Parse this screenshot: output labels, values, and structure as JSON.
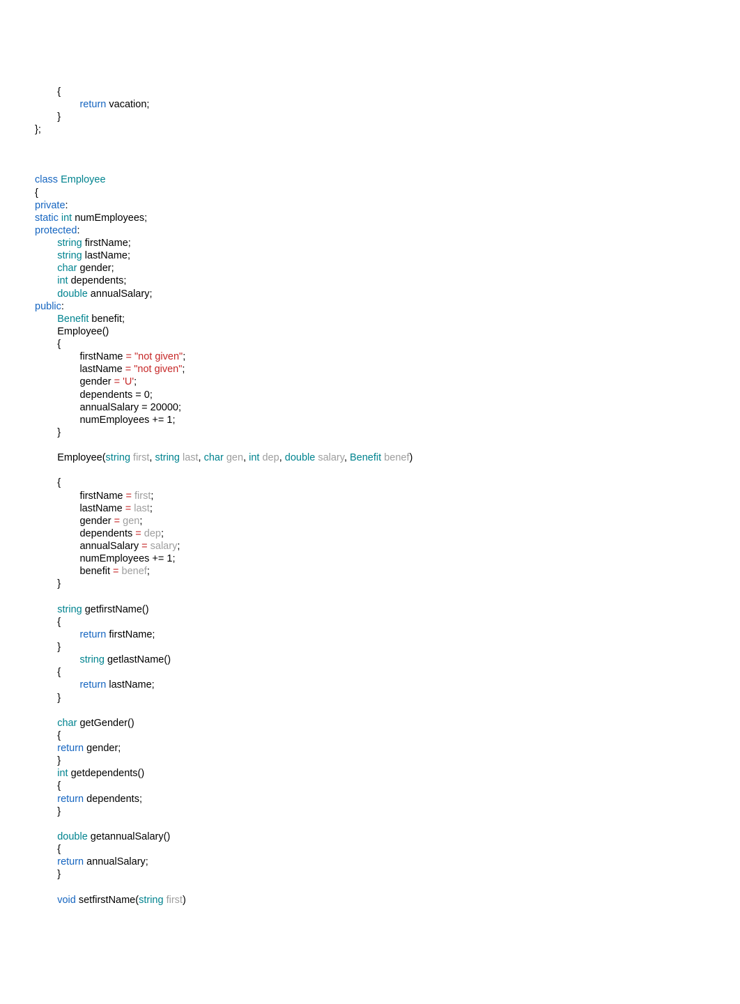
{
  "lines": [
    [
      {
        "t": "        {"
      }
    ],
    [
      {
        "t": "                "
      },
      {
        "t": "return",
        "c": "kw"
      },
      {
        "t": " vacation;"
      }
    ],
    [
      {
        "t": "        }"
      }
    ],
    [
      {
        "t": "};"
      }
    ],
    [
      {
        "t": ""
      }
    ],
    [
      {
        "t": ""
      }
    ],
    [
      {
        "t": ""
      }
    ],
    [
      {
        "t": "class",
        "c": "kw"
      },
      {
        "t": " "
      },
      {
        "t": "Employee",
        "c": "type"
      }
    ],
    [
      {
        "t": "{"
      }
    ],
    [
      {
        "t": "private",
        "c": "kw"
      },
      {
        "t": ":"
      }
    ],
    [
      {
        "t": "static",
        "c": "kw"
      },
      {
        "t": " "
      },
      {
        "t": "int",
        "c": "type"
      },
      {
        "t": " numEmployees;"
      }
    ],
    [
      {
        "t": "protected",
        "c": "kw"
      },
      {
        "t": ":"
      }
    ],
    [
      {
        "t": "        "
      },
      {
        "t": "string",
        "c": "type"
      },
      {
        "t": " firstName;"
      }
    ],
    [
      {
        "t": "        "
      },
      {
        "t": "string",
        "c": "type"
      },
      {
        "t": " lastName;"
      }
    ],
    [
      {
        "t": "        "
      },
      {
        "t": "char",
        "c": "type"
      },
      {
        "t": " gender;"
      }
    ],
    [
      {
        "t": "        "
      },
      {
        "t": "int",
        "c": "type"
      },
      {
        "t": " dependents;"
      }
    ],
    [
      {
        "t": "        "
      },
      {
        "t": "double",
        "c": "type"
      },
      {
        "t": " annualSalary;"
      }
    ],
    [
      {
        "t": "public",
        "c": "kw"
      },
      {
        "t": ":"
      }
    ],
    [
      {
        "t": "        "
      },
      {
        "t": "Benefit",
        "c": "type"
      },
      {
        "t": " benefit;"
      }
    ],
    [
      {
        "t": "        Employee()"
      }
    ],
    [
      {
        "t": "        {"
      }
    ],
    [
      {
        "t": "                firstName "
      },
      {
        "t": "=",
        "c": "op"
      },
      {
        "t": " "
      },
      {
        "t": "\"not given\"",
        "c": "str"
      },
      {
        "t": ";"
      }
    ],
    [
      {
        "t": "                lastName "
      },
      {
        "t": "=",
        "c": "op"
      },
      {
        "t": " "
      },
      {
        "t": "\"not given\"",
        "c": "str"
      },
      {
        "t": ";"
      }
    ],
    [
      {
        "t": "                gender "
      },
      {
        "t": "=",
        "c": "op"
      },
      {
        "t": " "
      },
      {
        "t": "'U'",
        "c": "str"
      },
      {
        "t": ";"
      }
    ],
    [
      {
        "t": "                dependents = 0;"
      }
    ],
    [
      {
        "t": "                annualSalary = 20000;"
      }
    ],
    [
      {
        "t": "                numEmployees += 1;"
      }
    ],
    [
      {
        "t": "        }"
      }
    ],
    [
      {
        "t": ""
      }
    ],
    [
      {
        "t": "        Employee("
      },
      {
        "t": "string",
        "c": "type"
      },
      {
        "t": " "
      },
      {
        "t": "first",
        "c": "param"
      },
      {
        "t": ", "
      },
      {
        "t": "string",
        "c": "type"
      },
      {
        "t": " "
      },
      {
        "t": "last",
        "c": "param"
      },
      {
        "t": ", "
      },
      {
        "t": "char",
        "c": "type"
      },
      {
        "t": " "
      },
      {
        "t": "gen",
        "c": "param"
      },
      {
        "t": ", "
      },
      {
        "t": "int",
        "c": "type"
      },
      {
        "t": " "
      },
      {
        "t": "dep",
        "c": "param"
      },
      {
        "t": ", "
      },
      {
        "t": "double",
        "c": "type"
      },
      {
        "t": " "
      },
      {
        "t": "salary",
        "c": "param"
      },
      {
        "t": ", "
      },
      {
        "t": "Benefit",
        "c": "type"
      },
      {
        "t": " "
      },
      {
        "t": "benef",
        "c": "param"
      },
      {
        "t": ")"
      }
    ],
    [
      {
        "t": ""
      }
    ],
    [
      {
        "t": "        {"
      }
    ],
    [
      {
        "t": "                firstName "
      },
      {
        "t": "=",
        "c": "op"
      },
      {
        "t": " "
      },
      {
        "t": "first",
        "c": "param"
      },
      {
        "t": ";"
      }
    ],
    [
      {
        "t": "                lastName "
      },
      {
        "t": "=",
        "c": "op"
      },
      {
        "t": " "
      },
      {
        "t": "last",
        "c": "param"
      },
      {
        "t": ";"
      }
    ],
    [
      {
        "t": "                gender "
      },
      {
        "t": "=",
        "c": "op"
      },
      {
        "t": " "
      },
      {
        "t": "gen",
        "c": "param"
      },
      {
        "t": ";"
      }
    ],
    [
      {
        "t": "                dependents "
      },
      {
        "t": "=",
        "c": "op"
      },
      {
        "t": " "
      },
      {
        "t": "dep",
        "c": "param"
      },
      {
        "t": ";"
      }
    ],
    [
      {
        "t": "                annualSalary "
      },
      {
        "t": "=",
        "c": "op"
      },
      {
        "t": " "
      },
      {
        "t": "salary",
        "c": "param"
      },
      {
        "t": ";"
      }
    ],
    [
      {
        "t": "                numEmployees += 1;"
      }
    ],
    [
      {
        "t": "                benefit "
      },
      {
        "t": "=",
        "c": "op"
      },
      {
        "t": " "
      },
      {
        "t": "benef",
        "c": "param"
      },
      {
        "t": ";"
      }
    ],
    [
      {
        "t": "        }"
      }
    ],
    [
      {
        "t": ""
      }
    ],
    [
      {
        "t": "        "
      },
      {
        "t": "string",
        "c": "type"
      },
      {
        "t": " getfirstName()"
      }
    ],
    [
      {
        "t": "        {"
      }
    ],
    [
      {
        "t": "                "
      },
      {
        "t": "return",
        "c": "kw"
      },
      {
        "t": " firstName;"
      }
    ],
    [
      {
        "t": "        }"
      }
    ],
    [
      {
        "t": "                "
      },
      {
        "t": "string",
        "c": "type"
      },
      {
        "t": " getlastName()"
      }
    ],
    [
      {
        "t": "        {"
      }
    ],
    [
      {
        "t": "                "
      },
      {
        "t": "return",
        "c": "kw"
      },
      {
        "t": " lastName;"
      }
    ],
    [
      {
        "t": "        }"
      }
    ],
    [
      {
        "t": ""
      }
    ],
    [
      {
        "t": "        "
      },
      {
        "t": "char",
        "c": "type"
      },
      {
        "t": " getGender()"
      }
    ],
    [
      {
        "t": "        {"
      }
    ],
    [
      {
        "t": "        "
      },
      {
        "t": "return",
        "c": "kw"
      },
      {
        "t": " gender;"
      }
    ],
    [
      {
        "t": "        }"
      }
    ],
    [
      {
        "t": "        "
      },
      {
        "t": "int",
        "c": "type"
      },
      {
        "t": " getdependents()"
      }
    ],
    [
      {
        "t": "        {"
      }
    ],
    [
      {
        "t": "        "
      },
      {
        "t": "return",
        "c": "kw"
      },
      {
        "t": " dependents;"
      }
    ],
    [
      {
        "t": "        }"
      }
    ],
    [
      {
        "t": ""
      }
    ],
    [
      {
        "t": "        "
      },
      {
        "t": "double",
        "c": "type"
      },
      {
        "t": " getannualSalary()"
      }
    ],
    [
      {
        "t": "        {"
      }
    ],
    [
      {
        "t": "        "
      },
      {
        "t": "return",
        "c": "kw"
      },
      {
        "t": " annualSalary;"
      }
    ],
    [
      {
        "t": "        }"
      }
    ],
    [
      {
        "t": ""
      }
    ],
    [
      {
        "t": "        "
      },
      {
        "t": "void",
        "c": "kw"
      },
      {
        "t": " setfirstName("
      },
      {
        "t": "string",
        "c": "type"
      },
      {
        "t": " "
      },
      {
        "t": "first",
        "c": "param"
      },
      {
        "t": ")"
      }
    ]
  ]
}
